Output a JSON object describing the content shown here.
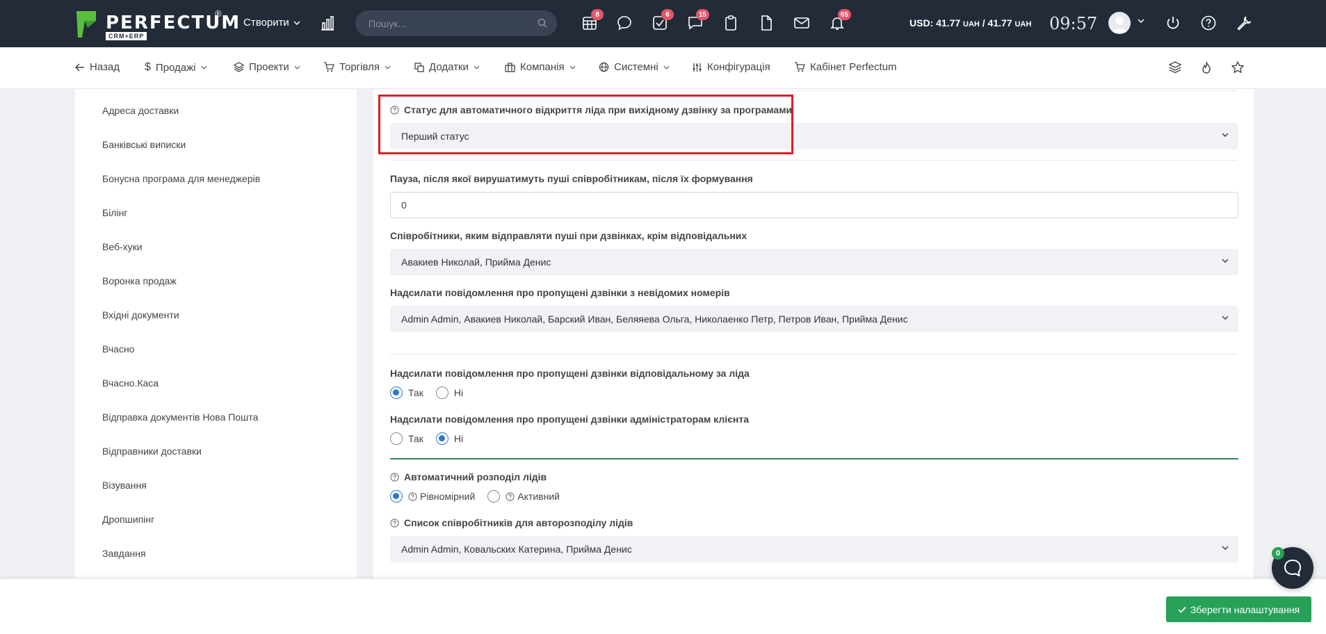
{
  "topbar": {
    "logo_text": "PERFECTUM",
    "logo_reg": "®",
    "logo_sub": "CRM+ERP",
    "create_label": "Створити",
    "search_placeholder": "Пошук...",
    "badges": {
      "calendar": "8",
      "tasks": "6",
      "chat": "15",
      "notifications": "65"
    },
    "currency_usd": "USD: 41.77",
    "currency_unit1": "UAH",
    "currency_sep": " / 41.77",
    "currency_unit2": "UAH",
    "time": "09:57"
  },
  "menu": {
    "back": "Назад",
    "sales": "Продажі",
    "projects": "Проекти",
    "trade": "Торгівля",
    "addons": "Додатки",
    "company": "Компанія",
    "system": "Системні",
    "config": "Конфігурація",
    "cabinet": "Кабінет Perfectum"
  },
  "sidebar": {
    "items": [
      "Адреса доставки",
      "Банківські виписки",
      "Бонусна програма для менеджерів",
      "Білінг",
      "Веб-хуки",
      "Воронка продаж",
      "Вхідні документи",
      "Вчасно",
      "Вчасно.Каса",
      "Відправка документів Нова Пошта",
      "Відправники доставки",
      "Візування",
      "Дропшипінг",
      "Завдання"
    ]
  },
  "form": {
    "status_label": "Статус для автоматичного відкриття ліда при вихідному дзвінку за програмами",
    "status_value": "Перший статус",
    "pause_label": "Пауза, після якої вирушатимуть пуші співробітникам, після їх формування",
    "pause_value": "0",
    "push_label": "Співробітники, яким відправляти пуші при дзвінках, крім відповідальних",
    "push_value": "Авакиев Николай, Прийма Денис",
    "unknown_label": "Надсилати повідомлення про пропущені дзвінки з невідомих номерів",
    "unknown_value": "Admin Admin, Авакиев Николай, Барский Иван, Беляяева Ольга, Николаенко Петр, Петров Иван, Прийма Денис",
    "missed_resp_label": "Надсилати повідомлення про пропущені дзвінки відповідальному за ліда",
    "missed_admin_label": "Надсилати повідомлення про пропущені дзвінки адміністраторам клієнта",
    "yes": "Так",
    "no": "Ні",
    "autodist_label": "Автоматичний розподіл лідів",
    "autodist_even": "Рівномірний",
    "autodist_active": "Активний",
    "autolist_label": "Список співробітників для авторозподілу лідів",
    "autolist_value": "Admin Admin, Ковальских Катерина, Прийма Денис"
  },
  "footer": {
    "save_label": "Зберегти налаштування",
    "chat_badge": "0"
  }
}
